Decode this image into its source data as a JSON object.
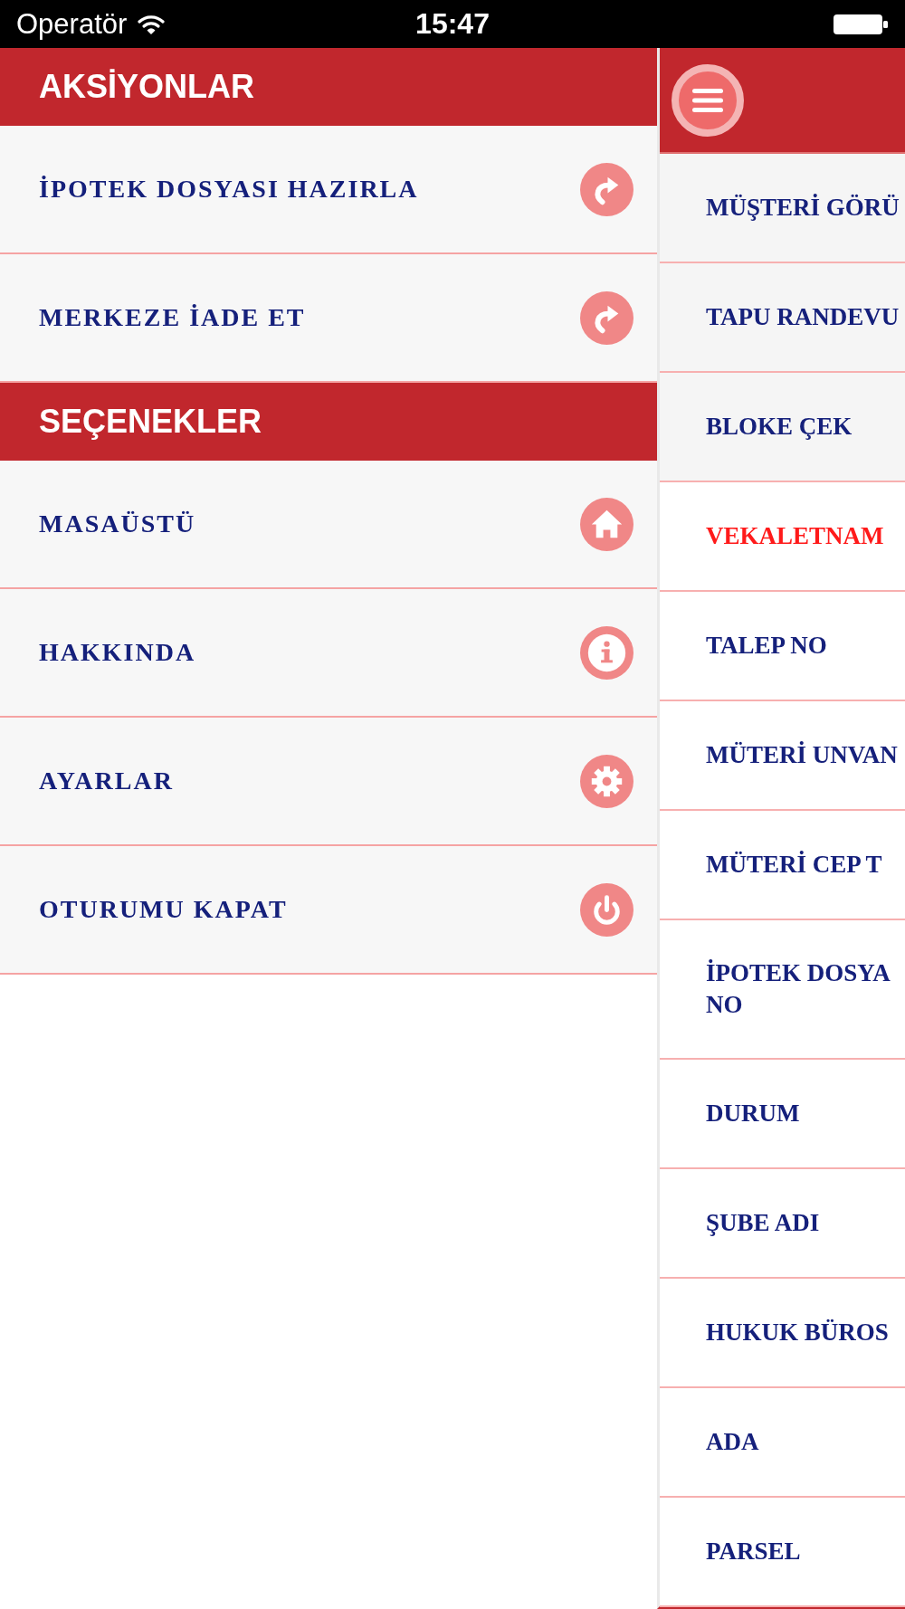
{
  "status_bar": {
    "carrier": "Operatör",
    "time": "15:47"
  },
  "side_menu": {
    "sections": [
      {
        "title": "AKSİYONLAR",
        "items": [
          {
            "label": "İPOTEK DOSYASI HAZIRLA"
          },
          {
            "label": "MERKEZE İADE ET"
          }
        ]
      },
      {
        "title": "SEÇENEKLER",
        "items": [
          {
            "label": "MASAÜSTÜ"
          },
          {
            "label": "HAKKINDA"
          },
          {
            "label": "AYARLAR"
          },
          {
            "label": "OTURUMU KAPAT"
          }
        ]
      }
    ]
  },
  "detail_panel": {
    "rows": [
      {
        "kind": "action",
        "label": "MÜŞTERİ GÖRÜ",
        "alert": false
      },
      {
        "kind": "action",
        "label": "TAPU RANDEVU",
        "alert": false
      },
      {
        "kind": "action",
        "label": "BLOKE ÇEK",
        "alert": false
      },
      {
        "kind": "field",
        "label": "VEKALETNAM",
        "alert": true
      },
      {
        "kind": "field",
        "label": "TALEP NO",
        "alert": false
      },
      {
        "kind": "field",
        "label": "MÜTERİ UNVAN",
        "alert": false
      },
      {
        "kind": "field",
        "label": "MÜTERİ CEP T",
        "alert": false
      },
      {
        "kind": "field",
        "label": "İPOTEK DOSYA\nNO",
        "alert": false
      },
      {
        "kind": "field",
        "label": "DURUM",
        "alert": false
      },
      {
        "kind": "field",
        "label": "ŞUBE ADI",
        "alert": false
      },
      {
        "kind": "field",
        "label": "HUKUK BÜROS",
        "alert": false
      },
      {
        "kind": "field",
        "label": "ADA",
        "alert": false
      },
      {
        "kind": "field",
        "label": "PARSEL",
        "alert": false
      }
    ]
  }
}
